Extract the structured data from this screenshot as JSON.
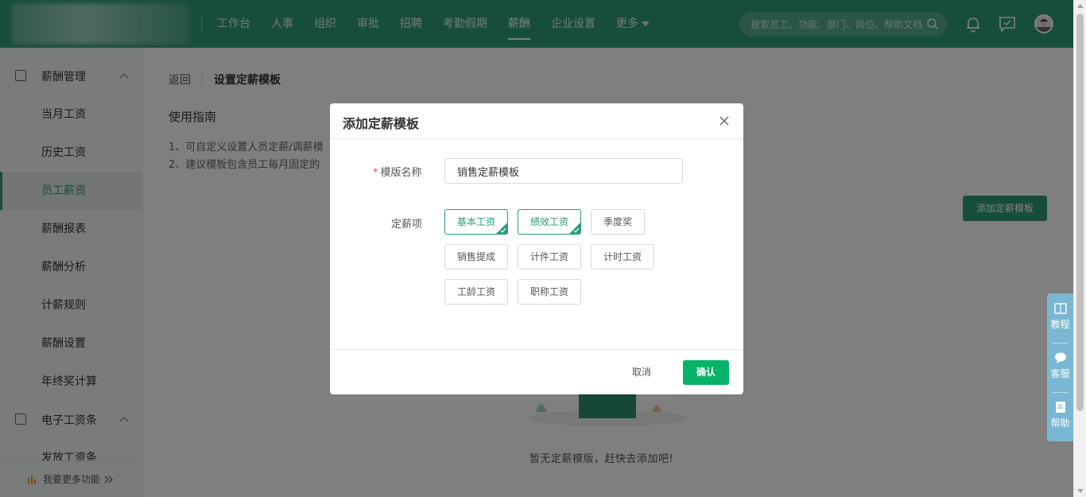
{
  "colors": {
    "brand": "#2e9c76",
    "confirm": "#07b26b",
    "required": "#e84a4a",
    "helper": "#7ab7d2"
  },
  "topnav": {
    "items": [
      "工作台",
      "人事",
      "组织",
      "审批",
      "招聘",
      "考勤假期",
      "薪酬",
      "企业设置",
      "更多"
    ],
    "active_index": 6,
    "search_placeholder": "搜索员工、功能、部门、岗位、帮助文档"
  },
  "sidebar": {
    "group1": "薪酬管理",
    "items": [
      "当月工资",
      "历史工资",
      "员工薪资",
      "薪酬报表",
      "薪酬分析",
      "计薪规则",
      "薪酬设置",
      "年终奖计算"
    ],
    "active_index": 2,
    "group2": "电子工资条",
    "group2_first": "发放工资条",
    "footer": "我要更多功能"
  },
  "main": {
    "back": "返回",
    "page_title": "设置定薪模板",
    "guide_title": "使用指南",
    "guide_lines": [
      "1、可自定义设置人员定薪/调薪模",
      "2、建议模板包含员工每月固定的"
    ],
    "add_button": "添加定薪模板",
    "empty_text": "暂无定薪模版，赶快去添加吧!"
  },
  "float_helper": [
    "教程",
    "客服",
    "帮助"
  ],
  "modal": {
    "title": "添加定薪模板",
    "name_label": "模版名称",
    "required_mark": "*",
    "name_value": "销售定薪模板",
    "items_label": "定薪项",
    "tags": [
      {
        "label": "基本工资",
        "selected": true
      },
      {
        "label": "绩效工资",
        "selected": true
      },
      {
        "label": "季度奖",
        "selected": false
      },
      {
        "label": "销售提成",
        "selected": false
      },
      {
        "label": "计件工资",
        "selected": false
      },
      {
        "label": "计时工资",
        "selected": false
      },
      {
        "label": "工龄工资",
        "selected": false
      },
      {
        "label": "职称工资",
        "selected": false
      }
    ],
    "cancel": "取消",
    "confirm": "确认"
  }
}
